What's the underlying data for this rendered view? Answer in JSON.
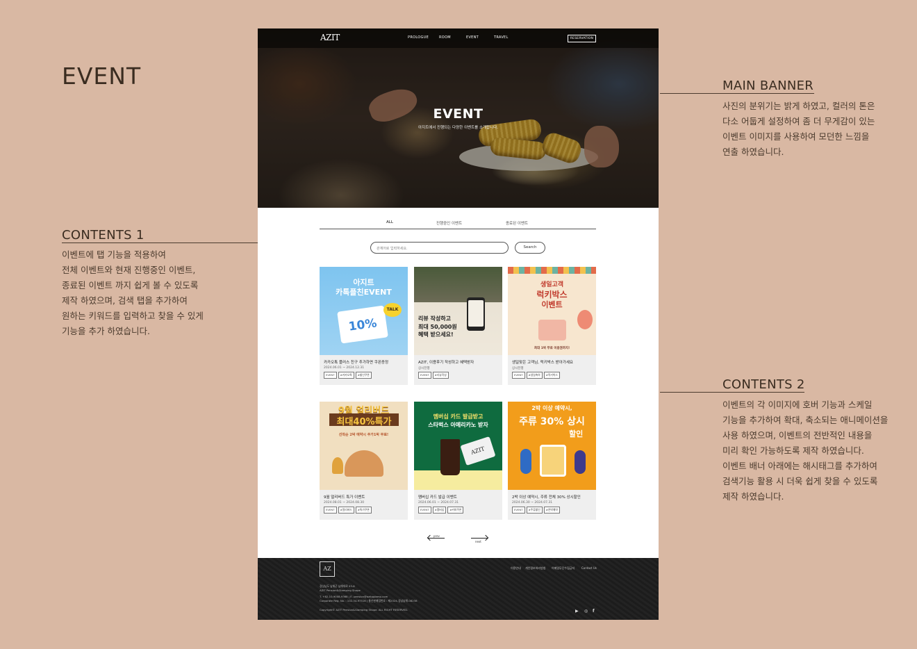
{
  "page_heading": "EVENT",
  "notes": [
    {
      "title": "MAIN BANNER",
      "body": "사진의 분위기는 밝게 하였고, 컬러의 톤은\n다소 어둡게 설정하여 좀 더 무게감이 있는\n이벤트 이미지를 사용하여 모던한 느낌을\n연출 하였습니다."
    },
    {
      "title": "CONTENTS 1",
      "body": "이벤트에 탭 기능을 적용하여\n전체 이벤트와 현재 진행중인 이벤트,\n종료된 이벤트 까지 쉽게 볼 수 있도록\n제작 하였으며, 검색 탭을 추가하여\n원하는 키워드를 입력하고 찾을 수 있게\n기능을 추가 하였습니다."
    },
    {
      "title": "CONTENTS 2",
      "body": "이벤트의 각 이미지에 호버 기능과 스케일\n기능을 추가하여 확대, 축소되는 애니메이션을\n사용 하였으며, 이벤트의 전반적인 내용을\n미리 확인 가능하도록 제작 하였습니다.\n이벤트 배너 아래에는 해시태그를 추가하여\n검색기능 활용 시  더욱 쉽게 찾을 수 있도록\n제작 하였습니다."
    }
  ],
  "site": {
    "logo": "AZIT",
    "nav": [
      "PROLOGUE",
      "ROOM",
      "EVENT",
      "TRAVEL"
    ],
    "reservation": "RESERVATION",
    "hero_title": "EVENT",
    "hero_sub": "아지트에서 진행되는 다양한 이벤트를 소개합니다.",
    "tabs": [
      "ALL",
      "진행중인 이벤트",
      "종료된 이벤트"
    ],
    "search_placeholder": "관계어로 입력하세요.",
    "search_button": "Search",
    "cards": [
      {
        "img_line1": "아지트",
        "img_line2": "카톡플친EVENT",
        "img_line3": "10%",
        "img_badge": "TALK",
        "title": "카카오톡 플러스 친구 추가하면 쿠폰증정",
        "date": "2024.06.01 ~ 2024.12.31",
        "tags": [
          "EVENT",
          "#카카오톡",
          "#할인쿠폰"
        ]
      },
      {
        "img_line1": "리뷰 작성하고",
        "img_line2": "최대 50,000원",
        "img_line3": "혜택 받으세요!",
        "img_badge": "",
        "title": "AZIT, 이용후기 작성하고 혜택받자",
        "date": "상시진행",
        "tags": [
          "EVENT",
          "#리뷰작성"
        ]
      },
      {
        "img_line1": "생일고객",
        "img_line2": "럭키박스",
        "img_line3": "이벤트",
        "img_badge": "최대 1박 무료 이용권까지!",
        "title": "생일맞은 고객님, 럭키박스 받아가세요",
        "date": "상시진행",
        "tags": [
          "EVENT",
          "#생일축하",
          "#럭키박스"
        ]
      },
      {
        "img_line1": "9월 얼리버드",
        "img_line2": "최대40%특가",
        "img_line3": "선착순 2박 예약시 추가1박 무료!",
        "img_badge": "",
        "title": "9월 얼리버드 특가 이벤트",
        "date": "2024.08.01 ~ 2024.08.30",
        "tags": [
          "EVENT",
          "#얼리버드",
          "#특가쿠폰"
        ]
      },
      {
        "img_line1": "멤버십 카드 발급받고",
        "img_line2": "스타벅스 아메리카노 받자",
        "img_line3": "",
        "img_badge": "AZIT",
        "title": "멤버십 카드 발급 이벤트",
        "date": "2024.06.01 ~ 2024.07.31",
        "tags": [
          "EVENT",
          "#멤버십",
          "#커피쿠폰"
        ]
      },
      {
        "img_line1": "2박 이상 예약시,",
        "img_line2": "주류 30% 상시",
        "img_line3": "할인",
        "img_badge": "",
        "title": "2박 이상 예약시, 주류 전체 30% 상시할인",
        "date": "2024.06.30 ~ 2024.07.31",
        "tags": [
          "EVENT",
          "#주류할인",
          "#연박예약"
        ]
      }
    ],
    "pager_prev": "prev",
    "pager_next": "next",
    "footer": {
      "logo": "AZ",
      "links": [
        "이용안내",
        "개인정보처리방침",
        "이메일무단수집금지",
        "Contact Us"
      ],
      "address": "경상남도 남해군 남해대로 93-8",
      "company": "AZIT Pension&Glamping Shope",
      "contact": "T. +82-10-9008-9368  |  E. pension@azitpglamp.com",
      "reg": "Corporate Reg. No. : 102-34-97516  |  통신판매업번호 : 제2024-경남남해-08238",
      "copyright": "Copyright© AZIT Pension&Glamping Shope. ALL RIGHT RESERVED.",
      "social": [
        "youtube-icon",
        "instagram-icon",
        "facebook-icon"
      ]
    }
  }
}
